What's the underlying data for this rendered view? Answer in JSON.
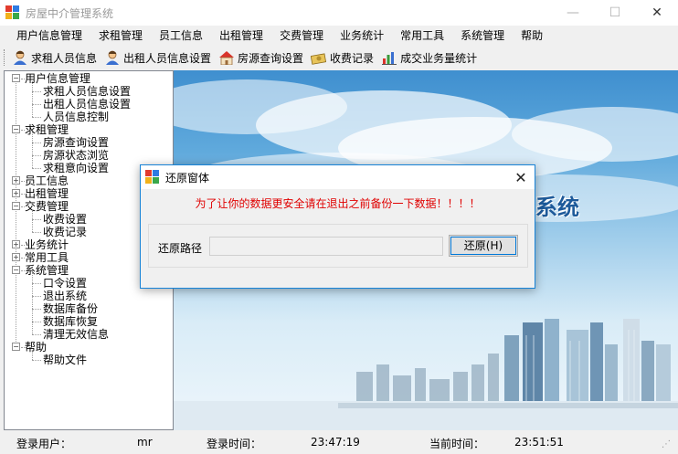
{
  "window": {
    "title": "房屋中介管理系统",
    "minimize_glyph": "—",
    "maximize_glyph": "☐",
    "close_glyph": "✕"
  },
  "menu": [
    "用户信息管理",
    "求租管理",
    "员工信息",
    "出租管理",
    "交费管理",
    "业务统计",
    "常用工具",
    "系统管理",
    "帮助"
  ],
  "toolbar": [
    {
      "label": "求租人员信息",
      "icon": "person-icon"
    },
    {
      "label": "出租人员信息设置",
      "icon": "person-icon"
    },
    {
      "label": "房源查询设置",
      "icon": "house-icon"
    },
    {
      "label": "收费记录",
      "icon": "money-icon"
    },
    {
      "label": "成交业务量统计",
      "icon": "chart-icon"
    }
  ],
  "tree": {
    "expanded_glyph": "−",
    "collapsed_glyph": "+",
    "groups": [
      {
        "label": "用户信息管理",
        "expanded": true,
        "children": [
          "求租人员信息设置",
          "出租人员信息设置",
          "人员信息控制"
        ]
      },
      {
        "label": "求租管理",
        "expanded": true,
        "children": [
          "房源查询设置",
          "房源状态浏览",
          "求租意向设置"
        ]
      },
      {
        "label": "员工信息",
        "expanded": false,
        "children": []
      },
      {
        "label": "出租管理",
        "expanded": false,
        "children": []
      },
      {
        "label": "交费管理",
        "expanded": true,
        "children": [
          "收费设置",
          "收费记录"
        ]
      },
      {
        "label": "业务统计",
        "expanded": false,
        "children": []
      },
      {
        "label": "常用工具",
        "expanded": false,
        "children": []
      },
      {
        "label": "系统管理",
        "expanded": true,
        "children": [
          "口令设置",
          "退出系统",
          "数据库备份",
          "数据库恢复",
          "清理无效信息"
        ]
      },
      {
        "label": "帮助",
        "expanded": true,
        "children": [
          "帮助文件"
        ]
      }
    ]
  },
  "background": {
    "banner_text": "系统"
  },
  "status": {
    "user_label": "登录用户：",
    "user_value": "mr",
    "login_time_label": "登录时间：",
    "login_time_value": "23:47:19",
    "current_time_label": "当前时间：",
    "current_time_value": "23:51:51"
  },
  "dialog": {
    "title": "还原窗体",
    "close_glyph": "✕",
    "warning": "为了让你的数据更安全请在退出之前备份一下数据！！！！",
    "path_label": "还原路径",
    "path_value": "",
    "restore_button": "还原(H)"
  },
  "colors": {
    "warning": "#e00000",
    "dialog_border": "#1883d7",
    "sky_top": "#3f8fcf"
  }
}
